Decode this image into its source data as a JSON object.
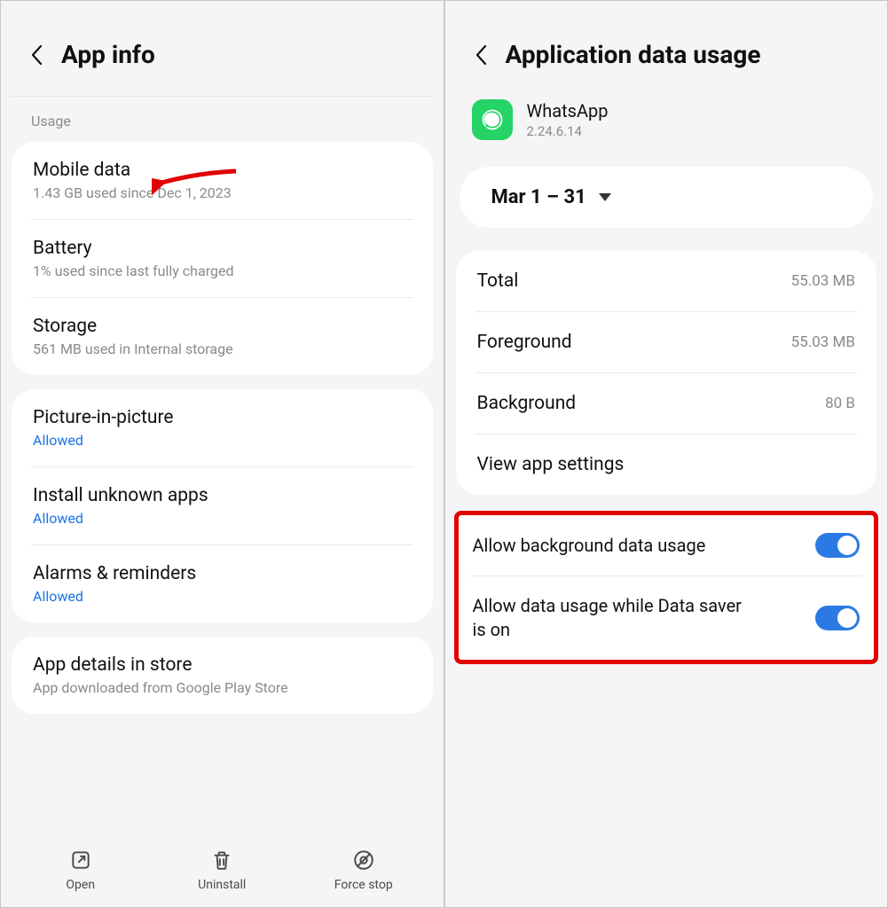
{
  "left": {
    "title": "App info",
    "sectionLabel": "Usage",
    "usage": [
      {
        "title": "Mobile data",
        "sub": "1.43 GB used since Dec 1, 2023"
      },
      {
        "title": "Battery",
        "sub": "1% used since last fully charged"
      },
      {
        "title": "Storage",
        "sub": "561 MB used in Internal storage"
      }
    ],
    "perms": [
      {
        "title": "Picture-in-picture",
        "sub": "Allowed"
      },
      {
        "title": "Install unknown apps",
        "sub": "Allowed"
      },
      {
        "title": "Alarms & reminders",
        "sub": "Allowed"
      }
    ],
    "details": {
      "title": "App details in store",
      "sub": "App downloaded from Google Play Store"
    },
    "bottom": [
      {
        "label": "Open"
      },
      {
        "label": "Uninstall"
      },
      {
        "label": "Force stop"
      }
    ]
  },
  "right": {
    "title": "Application data usage",
    "app": {
      "name": "WhatsApp",
      "version": "2.24.6.14"
    },
    "dateRange": "Mar 1 – 31",
    "stats": [
      {
        "label": "Total",
        "value": "55.03 MB"
      },
      {
        "label": "Foreground",
        "value": "55.03 MB"
      },
      {
        "label": "Background",
        "value": "80 B"
      }
    ],
    "viewSettings": "View app settings",
    "toggles": [
      {
        "label": "Allow background data usage",
        "on": true
      },
      {
        "label": "Allow data usage while Data saver is on",
        "on": true
      }
    ]
  }
}
